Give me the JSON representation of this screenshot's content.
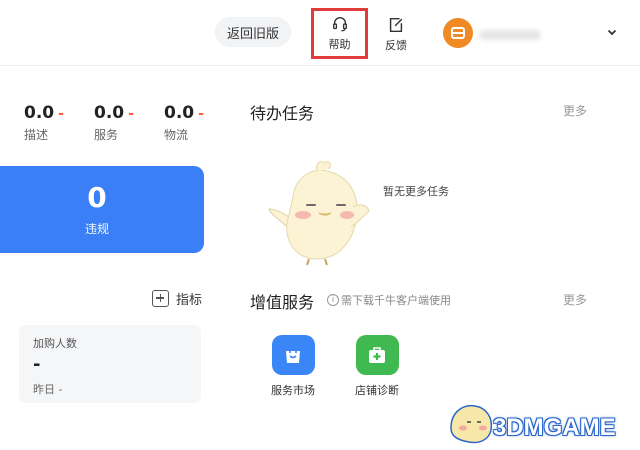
{
  "header": {
    "old_version_label": "返回旧版",
    "help_label": "帮助",
    "feedback_label": "反馈",
    "help_icon": "headset-icon",
    "feedback_icon": "edit-note-icon",
    "avatar_initial": "日",
    "highlight_color": "#e23b3b"
  },
  "stats": [
    {
      "value": "0.0",
      "delta": "-",
      "label": "描述"
    },
    {
      "value": "0.0",
      "delta": "-",
      "label": "服务"
    },
    {
      "value": "0.0",
      "delta": "-",
      "label": "物流"
    }
  ],
  "violation": {
    "count": "0",
    "label": "违规",
    "color": "#3a7ff6"
  },
  "metric_button": {
    "label": "指标"
  },
  "cart": {
    "title": "加购人数",
    "value": "-",
    "yesterday": "昨日 -"
  },
  "todo": {
    "title": "待办任务",
    "more": "更多",
    "empty_text": "暂无更多任务"
  },
  "value_services": {
    "title": "增值服务",
    "hint": "需下载千牛客户端使用",
    "more": "更多",
    "items": [
      {
        "label": "服务市场",
        "icon": "shopping-bag-icon",
        "color": "#3b86f7"
      },
      {
        "label": "店铺诊断",
        "icon": "first-aid-icon",
        "color": "#3fb950"
      }
    ]
  },
  "watermark": {
    "text": "3DMGAME"
  }
}
